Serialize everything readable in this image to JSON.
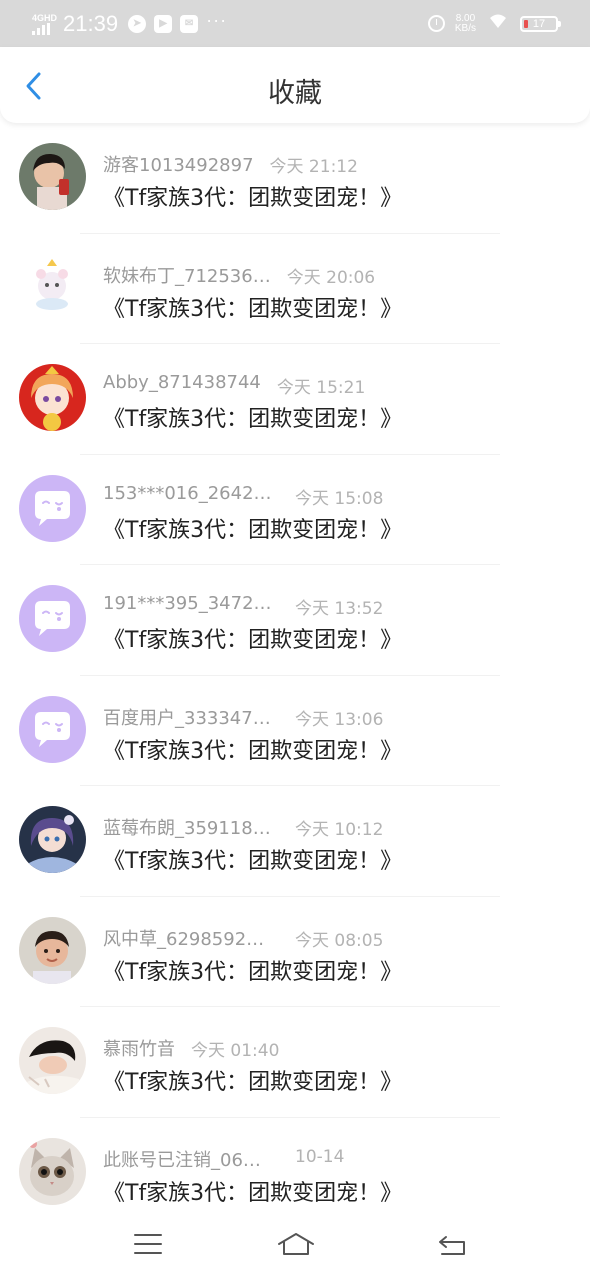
{
  "status_bar": {
    "network": "4GHD",
    "time": "21:39",
    "speed_value": "8.00",
    "speed_unit": "KB/s",
    "battery": "17"
  },
  "header": {
    "title": "收藏"
  },
  "items": [
    {
      "user": "游客1013492897",
      "time": "今天 21:12",
      "title": "《Tf家族3代：团欺变团宠！》",
      "avatar": "girl-photo"
    },
    {
      "user": "软妹布丁_712536…",
      "time": "今天 20:06",
      "title": "《Tf家族3代：团欺变团宠！》",
      "avatar": "cartoon-bear"
    },
    {
      "user": "Abby_871438744",
      "time": "今天 15:21",
      "title": "《Tf家族3代：团欺变团宠！》",
      "avatar": "anime-girl-red"
    },
    {
      "user": "153***016_2642…",
      "time": "今天 15:08",
      "title": "《Tf家族3代：团欺变团宠！》",
      "avatar": "default-chat"
    },
    {
      "user": "191***395_3472…",
      "time": "今天 13:52",
      "title": "《Tf家族3代：团欺变团宠！》",
      "avatar": "default-chat"
    },
    {
      "user": "百度用户_333347…",
      "time": "今天 13:06",
      "title": "《Tf家族3代：团欺变团宠！》",
      "avatar": "default-chat"
    },
    {
      "user": "蓝莓布朗_359118…",
      "time": "今天 10:12",
      "title": "《Tf家族3代：团欺变团宠！》",
      "avatar": "anime-girl-blue"
    },
    {
      "user": "风中草_6298592…",
      "time": "今天 08:05",
      "title": "《Tf家族3代：团欺变团宠！》",
      "avatar": "baby-photo"
    },
    {
      "user": "慕雨竹音",
      "time": "今天 01:40",
      "title": "《Tf家族3代：团欺变团宠！》",
      "avatar": "sleeping-photo"
    },
    {
      "user": "此账号已注销_06…",
      "time": "10-14",
      "title": "《Tf家族3代：团欺变团宠！》",
      "avatar": "cat-photo"
    }
  ],
  "colors": {
    "accent": "#2f8ee5",
    "default_avatar": "#ccb6f6",
    "status_bar": "#d9d9d9"
  }
}
